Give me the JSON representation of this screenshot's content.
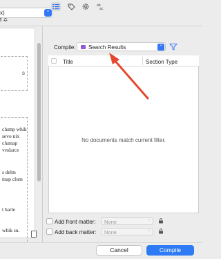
{
  "header": {
    "format_value": "x)"
  },
  "left_panel": {
    "dropdown_value": "t ≎",
    "dashed_box_text": "s",
    "sample_lines": [
      "clump whik",
      "sevo nix",
      "clumap",
      "vrnlarce",
      "",
      "s delm",
      "map clum",
      "",
      "",
      "t harle",
      "",
      "whik su."
    ]
  },
  "tabs": [
    {
      "name": "list-icon"
    },
    {
      "name": "tag-icon"
    },
    {
      "name": "gear-icon"
    },
    {
      "name": "replace-text-icon",
      "label": "ab\n→ac"
    }
  ],
  "compile": {
    "label": "Compile:",
    "value": "Search Results",
    "swatch_color": "#8d5bd6",
    "accent": "#3478f6"
  },
  "table": {
    "columns": [
      "Title",
      "Section Type"
    ],
    "empty_message": "No documents match current filter."
  },
  "front_matter": {
    "label": "Add front matter:",
    "value": "None"
  },
  "back_matter": {
    "label": "Add back matter:",
    "value": "None"
  },
  "footer": {
    "cancel_label": "Cancel",
    "compile_label": "Compile",
    "primary_color": "#2f7bf5"
  },
  "annotation": {
    "arrow_color": "#e4472f"
  }
}
